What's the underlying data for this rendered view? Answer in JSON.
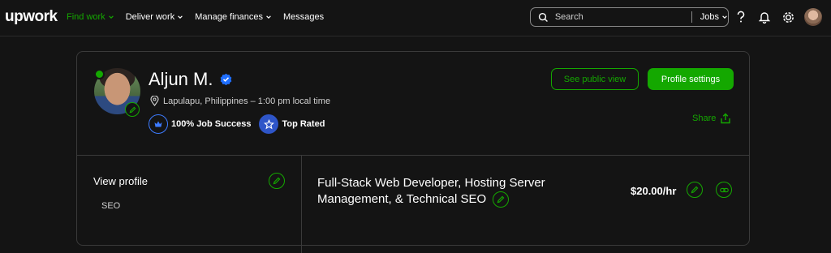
{
  "topbar": {
    "logo": "upwork",
    "nav": [
      {
        "label": "Find work",
        "active": true,
        "has_chevron": true
      },
      {
        "label": "Deliver work",
        "active": false,
        "has_chevron": true
      },
      {
        "label": "Manage finances",
        "active": false,
        "has_chevron": true
      },
      {
        "label": "Messages",
        "active": false,
        "has_chevron": false
      }
    ],
    "search": {
      "placeholder": "Search",
      "scope": "Jobs"
    },
    "icons": [
      "help-icon",
      "notification-bell-icon",
      "settings-icon",
      "user-avatar"
    ]
  },
  "profile": {
    "name": "Aljun M.",
    "verified": true,
    "location": "Lapulapu, Philippines – 1:00 pm local time",
    "badges": [
      {
        "label": "100% Job Success",
        "icon": "job-success-icon"
      },
      {
        "label": "Top Rated",
        "icon": "top-rated-icon"
      }
    ],
    "online": true
  },
  "actions": {
    "see_public_view": "See public view",
    "profile_settings": "Profile settings",
    "share": "Share"
  },
  "sidebar": {
    "view_profile": "View profile",
    "items": [
      "SEO"
    ]
  },
  "main": {
    "title_line1": "Full-Stack Web Developer, Hosting Server",
    "title_line2": "Management, & Technical SEO",
    "rate": "$20.00/hr"
  },
  "colors": {
    "background": "#141414",
    "accent_green": "#14a800",
    "verified_blue": "#1f6fff",
    "border": "#3a3a3a"
  }
}
